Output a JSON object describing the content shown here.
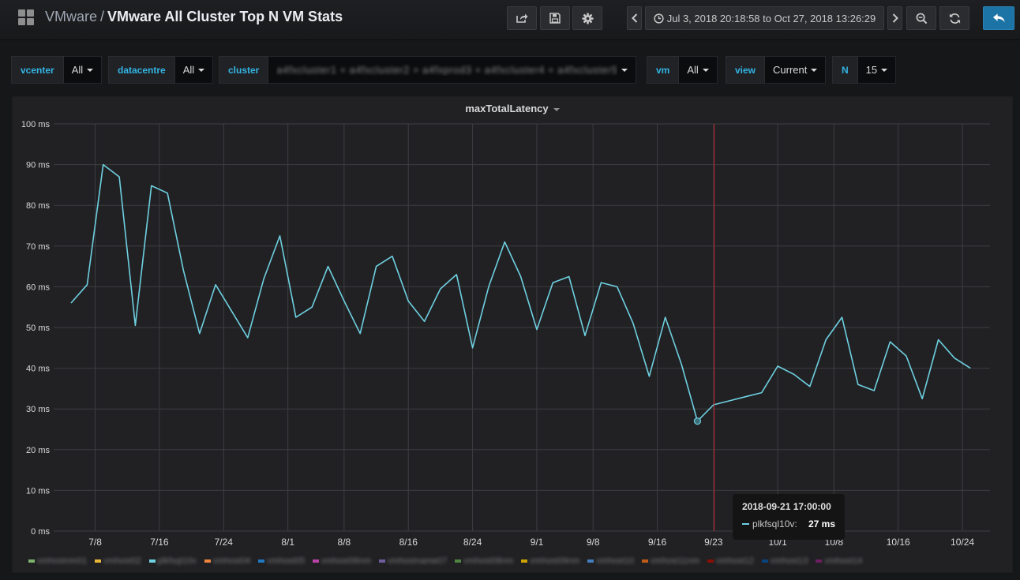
{
  "navbar": {
    "folder": "VMware",
    "separator": "/",
    "title": "VMware All Cluster Top N VM Stats",
    "time_range": "Jul 3, 2018 20:18:58 to Oct 27, 2018 13:26:29",
    "icons": [
      "grid-icon",
      "share-icon",
      "save-icon",
      "gear-icon",
      "chevron-left-icon",
      "clock-icon",
      "chevron-right-icon",
      "zoom-out-icon",
      "refresh-icon",
      "back-icon"
    ]
  },
  "variables": [
    {
      "label": "vcenter",
      "value": "All"
    },
    {
      "label": "datacentre",
      "value": "All"
    },
    {
      "label": "cluster",
      "value": "                                                  "
    },
    {
      "label": "vm",
      "value": "All"
    },
    {
      "label": "view",
      "value": "Current"
    },
    {
      "label": "N",
      "value": "15"
    }
  ],
  "panel": {
    "title": "maxTotalLatency"
  },
  "tooltip": {
    "time": "2018-09-21 17:00:00",
    "series": "plkfsql10v:",
    "value": "27 ms"
  },
  "colors": {
    "series": "#6ed0e0",
    "crosshair": "#c0262e",
    "grid": "#3d3e42"
  },
  "chart_data": {
    "type": "line",
    "title": "maxTotalLatency",
    "ylabel": "",
    "xlabel": "",
    "y_unit": "ms",
    "ylim": [
      0,
      100
    ],
    "yticks": [
      "0 ms",
      "10 ms",
      "20 ms",
      "30 ms",
      "40 ms",
      "50 ms",
      "60 ms",
      "70 ms",
      "80 ms",
      "90 ms",
      "100 ms"
    ],
    "xticks": [
      "7/8",
      "7/16",
      "7/24",
      "8/1",
      "8/8",
      "8/16",
      "8/24",
      "9/1",
      "9/8",
      "9/16",
      "9/23",
      "10/1",
      "10/8",
      "10/16",
      "10/24"
    ],
    "grid": true,
    "hover_x": "2018-09-21 17:00",
    "series": [
      {
        "name": "plkfsql10v",
        "x": [
          "2018-07-05",
          "2018-07-07",
          "2018-07-09",
          "2018-07-11",
          "2018-07-13",
          "2018-07-15",
          "2018-07-17",
          "2018-07-19",
          "2018-07-21",
          "2018-07-23",
          "2018-07-25",
          "2018-07-27",
          "2018-07-29",
          "2018-07-31",
          "2018-08-02",
          "2018-08-04",
          "2018-08-06",
          "2018-08-08",
          "2018-08-10",
          "2018-08-12",
          "2018-08-14",
          "2018-08-16",
          "2018-08-18",
          "2018-08-20",
          "2018-08-22",
          "2018-08-24",
          "2018-08-26",
          "2018-08-28",
          "2018-08-30",
          "2018-09-01",
          "2018-09-03",
          "2018-09-05",
          "2018-09-07",
          "2018-09-09",
          "2018-09-11",
          "2018-09-13",
          "2018-09-15",
          "2018-09-17",
          "2018-09-19",
          "2018-09-21",
          "2018-09-23",
          "2018-09-25",
          "2018-09-27",
          "2018-09-29",
          "2018-10-01",
          "2018-10-03",
          "2018-10-05",
          "2018-10-07",
          "2018-10-09",
          "2018-10-11",
          "2018-10-13",
          "2018-10-15",
          "2018-10-17",
          "2018-10-19",
          "2018-10-21",
          "2018-10-23",
          "2018-10-25"
        ],
        "values": [
          56,
          60.5,
          90,
          87,
          50.5,
          84.8,
          83,
          64,
          48.5,
          60.5,
          54,
          47.5,
          62,
          72.5,
          52.5,
          55,
          65,
          56.5,
          48.5,
          65,
          67.5,
          56.5,
          51.5,
          59.5,
          63,
          45,
          60,
          71,
          62.5,
          49.5,
          61,
          62.5,
          48,
          61,
          60,
          51,
          38,
          52.5,
          41,
          27,
          31,
          32,
          33,
          34,
          40.5,
          38.5,
          35.5,
          47,
          52.5,
          36,
          34.5,
          46.5,
          43,
          32.5,
          47,
          42.5,
          40
        ]
      }
    ],
    "legend": "bottom"
  }
}
